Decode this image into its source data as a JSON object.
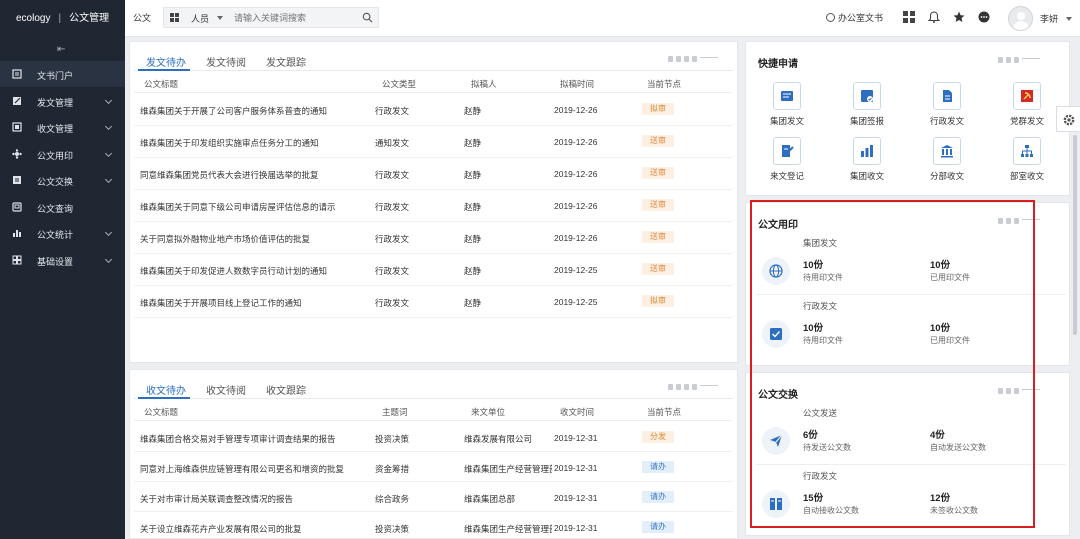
{
  "header": {
    "brand": "ecology",
    "product": "公文管理",
    "module": "公文",
    "search_type": "人员",
    "search_placeholder": "请输入关键词搜索",
    "office_doc": "办公室文书",
    "user_name": "李妍"
  },
  "sidebar": {
    "collapse_glyph": "⇤",
    "items": [
      {
        "label": "文书门户",
        "icon": "portal-icon",
        "active": true,
        "expandable": false
      },
      {
        "label": "发文管理",
        "icon": "send-doc-icon",
        "expandable": true
      },
      {
        "label": "收文管理",
        "icon": "receive-doc-icon",
        "expandable": true
      },
      {
        "label": "公文用印",
        "icon": "seal-icon",
        "expandable": true
      },
      {
        "label": "公文交换",
        "icon": "exchange-icon",
        "expandable": true
      },
      {
        "label": "公文查询",
        "icon": "query-icon",
        "expandable": false
      },
      {
        "label": "公文统计",
        "icon": "stats-icon",
        "expandable": true
      },
      {
        "label": "基础设置",
        "icon": "settings-icon",
        "expandable": true
      }
    ]
  },
  "send_panel": {
    "tabs": [
      "发文待办",
      "发文待阅",
      "发文跟踪"
    ],
    "columns": [
      "公文标题",
      "公文类型",
      "拟稿人",
      "拟稿时间",
      "当前节点"
    ],
    "rows": [
      {
        "title": "维森集团关于开展了公司客户服务体系普查的通知",
        "type": "行政发文",
        "drafter": "赵静",
        "date": "2019-12-26",
        "node": "拟审"
      },
      {
        "title": "维森集团关于印发组织实施审点任务分工的通知",
        "type": "通知发文",
        "drafter": "赵静",
        "date": "2019-12-26",
        "node": "送审"
      },
      {
        "title": "同意维森集团党员代表大会进行换届选举的批复",
        "type": "行政发文",
        "drafter": "赵静",
        "date": "2019-12-26",
        "node": "送审"
      },
      {
        "title": "维森集团关于同意下级公司申请房屋评估信息的请示",
        "type": "行政发文",
        "drafter": "赵静",
        "date": "2019-12-26",
        "node": "送审"
      },
      {
        "title": "关于同意拟外融物业地产市场价值评估的批复",
        "type": "行政发文",
        "drafter": "赵静",
        "date": "2019-12-26",
        "node": "送审"
      },
      {
        "title": "维森集团关于印发促进人数数字员行动计划的通知",
        "type": "行政发文",
        "drafter": "赵静",
        "date": "2019-12-25",
        "node": "送审"
      },
      {
        "title": "维森集团关于开展项目线上登记工作的通知",
        "type": "行政发文",
        "drafter": "赵静",
        "date": "2019-12-25",
        "node": "拟审"
      }
    ]
  },
  "receive_panel": {
    "tabs": [
      "收文待办",
      "收文待阅",
      "收文跟踪"
    ],
    "columns": [
      "公文标题",
      "主题词",
      "来文单位",
      "收文时间",
      "当前节点"
    ],
    "rows": [
      {
        "title": "维森集团合格交易对手管理专项审计调查结果的报告",
        "keyword": "投资决策",
        "source": "维森发展有限公司",
        "date": "2019-12-31",
        "node": "分发",
        "color": "orange"
      },
      {
        "title": "同意对上海维森供应链管理有限公司更名和增资的批复",
        "keyword": "资金筹措",
        "source": "维森集团生产经营管理部",
        "date": "2019-12-31",
        "node": "请办",
        "color": "blue"
      },
      {
        "title": "关于对市审计局关联调查整改情况的报告",
        "keyword": "综合政务",
        "source": "维森集团总部",
        "date": "2019-12-31",
        "node": "请办",
        "color": "blue"
      },
      {
        "title": "关于设立维森花卉产业发展有限公司的批复",
        "keyword": "投资决策",
        "source": "维森集团生产经营管理部",
        "date": "2019-12-31",
        "node": "请办",
        "color": "blue"
      }
    ]
  },
  "quick_apply": {
    "title": "快捷申请",
    "items": [
      {
        "label": "集团发文",
        "icon": "group-doc-icon"
      },
      {
        "label": "集团签报",
        "icon": "group-report-icon"
      },
      {
        "label": "行政发文",
        "icon": "admin-doc-icon"
      },
      {
        "label": "党群发文",
        "icon": "party-doc-icon"
      },
      {
        "label": "来文登记",
        "icon": "register-icon"
      },
      {
        "label": "集团收文",
        "icon": "group-receive-icon"
      },
      {
        "label": "分部收文",
        "icon": "branch-receive-icon"
      },
      {
        "label": "部室收文",
        "icon": "dept-receive-icon"
      }
    ]
  },
  "seal_panel": {
    "title": "公文用印",
    "cards": [
      {
        "subtitle": "集团发文",
        "icon": "globe-icon",
        "left_num": "10份",
        "left_label": "待用印文件",
        "right_num": "10份",
        "right_label": "已用印文件"
      },
      {
        "subtitle": "行政发文",
        "icon": "stamp-icon",
        "left_num": "10份",
        "left_label": "待用印文件",
        "right_num": "10份",
        "right_label": "已用印文件"
      }
    ]
  },
  "exchange_panel": {
    "title": "公文交换",
    "cards": [
      {
        "subtitle": "公文发送",
        "icon": "send-plane-icon",
        "left_num": "6份",
        "left_label": "待发送公文数",
        "right_num": "4份",
        "right_label": "自动发送公文数"
      },
      {
        "subtitle": "行政发文",
        "icon": "receive-box-icon",
        "left_num": "15份",
        "left_label": "自动接收公文数",
        "right_num": "12份",
        "right_label": "未签收公文数"
      }
    ]
  },
  "colors": {
    "sidebar_bg": "#1f2733",
    "accent": "#2d6ec0",
    "highlight_border": "#d81e1e",
    "badge_orange": "#e28a36",
    "badge_blue": "#3a78c8"
  }
}
